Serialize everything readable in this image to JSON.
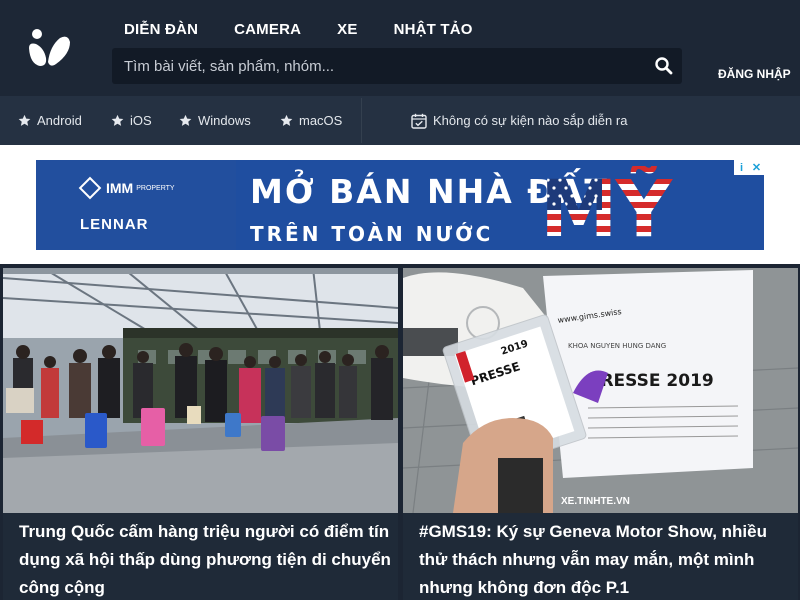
{
  "header": {
    "nav": [
      "DIỄN ĐÀN",
      "CAMERA",
      "XE",
      "NHẬT TẢO"
    ],
    "search_placeholder": "Tìm bài viết, sản phẩm, nhóm...",
    "login_label": "ĐĂNG NHẬP",
    "logo_icon": "tinhte-logo-icon",
    "search_icon": "search-icon"
  },
  "subnav": {
    "items": [
      {
        "label": "Android",
        "icon": "star-icon"
      },
      {
        "label": "iOS",
        "icon": "star-icon"
      },
      {
        "label": "Windows",
        "icon": "star-icon"
      },
      {
        "label": "macOS",
        "icon": "star-icon"
      }
    ],
    "event_label": "Không có sự kiện nào sắp diễn ra",
    "event_icon": "calendar-check-icon"
  },
  "ad": {
    "brand1": "IMM",
    "brand1_suffix": "PROPERTY",
    "brand2": "LENNAR",
    "line1": "MỞ BÁN NHÀ ĐẤT",
    "line2": "TRÊN TOÀN NƯỚC",
    "highlight": "MỸ",
    "info_symbol": "i",
    "close_symbol": "✕"
  },
  "articles": [
    {
      "title": "Trung Quốc cấm hàng triệu người có điểm tín dụng xã hội thấp dùng phương tiện di chuyển công cộng"
    },
    {
      "title": "#GMS19: Ký sự Geneva Motor Show, nhiều thử thách nhưng vẫn may mắn, một mình nhưng không đơn độc P.1",
      "image_text": {
        "badge": "PRESSE",
        "badge_year": "2019",
        "sheet_main": "PRESSE 2019",
        "sheet_url": "www.gims.swiss",
        "watermark": "XE.TINHTE.VN"
      }
    }
  ],
  "colors": {
    "header_bg": "#1d2736",
    "subnav_bg": "#253142",
    "page_bg": "#1c2533",
    "ad_blue": "#1f4ea0"
  }
}
